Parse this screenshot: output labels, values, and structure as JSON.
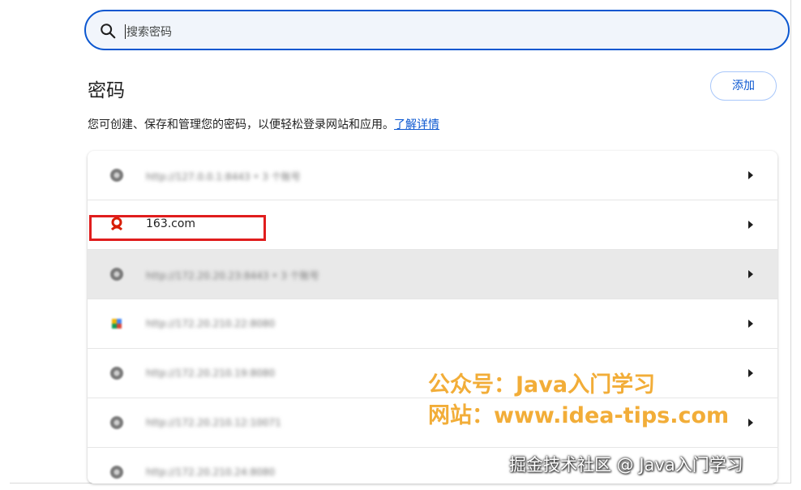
{
  "search": {
    "placeholder": "搜索密码"
  },
  "page": {
    "title": "密码",
    "add_label": "添加",
    "description": "您可创建、保存和管理您的密码，以便轻松登录网站和应用。",
    "learn_more": "了解详情"
  },
  "rows": [
    {
      "text": "http://127.0.0.1:8443  • 3 个账号",
      "favicon": "globe-icon",
      "blurred": true
    },
    {
      "text": "163.com",
      "favicon": "netease-icon",
      "blurred": false
    },
    {
      "text": "http://172.20.20.23:8443  • 3 个账号",
      "favicon": "globe-icon",
      "blurred": true
    },
    {
      "text": "http://172.20.210.22:8080",
      "favicon": "colorful-icon",
      "blurred": true
    },
    {
      "text": "http://172.20.210.19:8080",
      "favicon": "globe-icon",
      "blurred": true
    },
    {
      "text": "http://172.20.210.12:10071",
      "favicon": "globe-icon",
      "blurred": true
    },
    {
      "text": "http://172.20.210.24:8080",
      "favicon": "globe-icon",
      "blurred": true
    }
  ],
  "watermark": {
    "line1": "公众号：Java入门学习",
    "line2": "网站：www.idea-tips.com",
    "line3": "掘金技术社区 @ Java入门学习"
  },
  "colors": {
    "accent": "#0b57d0",
    "highlight": "#e01d1d",
    "watermark": "#f0a21c"
  }
}
